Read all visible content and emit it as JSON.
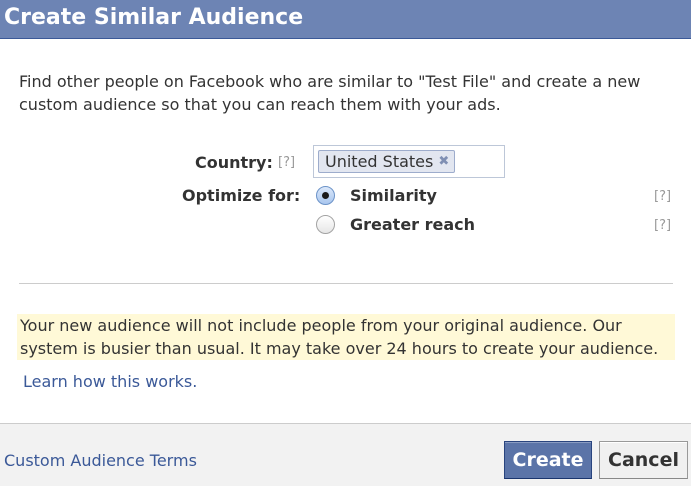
{
  "dialog": {
    "title": "Create Similar Audience",
    "intro": "Find other people on Facebook who are similar to \"Test File\" and create a new custom audience so that you can reach them with your ads."
  },
  "form": {
    "country": {
      "label": "Country:",
      "help": "[?]",
      "selected_token": "United States",
      "remove_glyph": "✖"
    },
    "optimize": {
      "label": "Optimize for:",
      "options": [
        {
          "label": "Similarity",
          "checked": true,
          "help": "[?]"
        },
        {
          "label": "Greater reach",
          "checked": false,
          "help": "[?]"
        }
      ]
    }
  },
  "notice": {
    "text": "Your new audience will not include people from your original audience. Our system is busier than usual. It may take over 24 hours to create your audience."
  },
  "learn_link": "Learn how this works.",
  "footer": {
    "terms_link": "Custom Audience Terms",
    "create_label": "Create",
    "cancel_label": "Cancel"
  },
  "colors": {
    "header_bg": "#6d84b4",
    "link": "#3b5998",
    "notice_bg": "#fff9d7",
    "primary_button": "#5b74a8"
  }
}
